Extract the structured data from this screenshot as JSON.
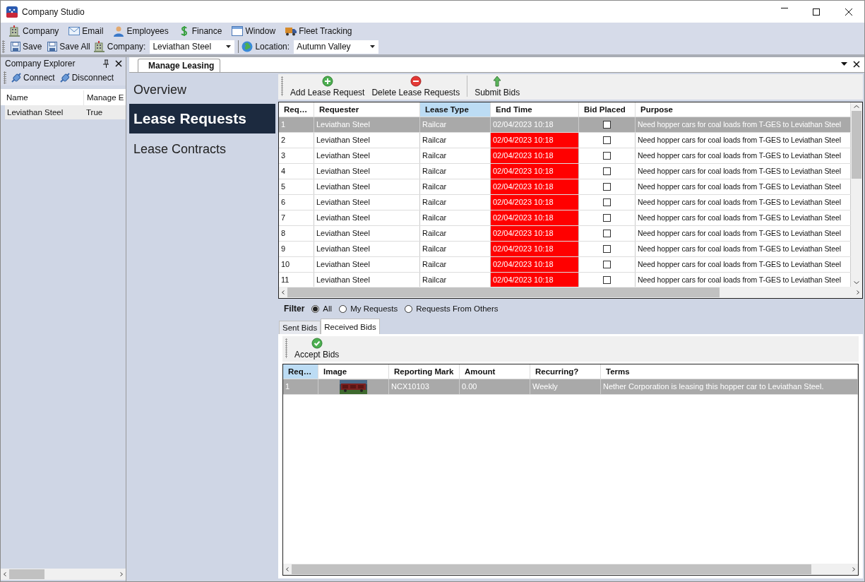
{
  "window": {
    "title": "Company Studio"
  },
  "menu": [
    {
      "label": "Company",
      "kind": "building"
    },
    {
      "label": "Email",
      "kind": "mail"
    },
    {
      "label": "Employees",
      "kind": "person"
    },
    {
      "label": "Finance",
      "kind": "dollar"
    },
    {
      "label": "Window",
      "kind": "window"
    },
    {
      "label": "Fleet Tracking",
      "kind": "truck"
    }
  ],
  "toolbar": {
    "buttons": [
      {
        "label": "Save",
        "kind": "save"
      },
      {
        "label": "Save All",
        "kind": "save"
      }
    ],
    "company": {
      "label": "Company:",
      "value": "Leviathan Steel"
    },
    "location": {
      "label": "Location:",
      "value": "Autumn Valley"
    }
  },
  "explorer": {
    "title": "Company Explorer",
    "buttons": [
      {
        "label": "Connect"
      },
      {
        "label": "Disconnect"
      }
    ],
    "columns": [
      "Name",
      "Manage E"
    ],
    "rows": [
      {
        "cells": [
          "Leviathan Steel",
          "True"
        ],
        "selected": true
      }
    ]
  },
  "document_tabs": [
    {
      "label": "Manage Leasing",
      "selected": true
    }
  ],
  "nav": [
    {
      "label": "Overview",
      "selected": false
    },
    {
      "label": "Lease Requests",
      "selected": true
    },
    {
      "label": "Lease Contracts",
      "selected": false
    }
  ],
  "requests_toolbar": [
    {
      "label": "Add Lease Request",
      "kind": "add"
    },
    {
      "label": "Delete Lease Requests",
      "kind": "delete"
    },
    {
      "label": "Submit Bids",
      "kind": "submit"
    }
  ],
  "requests_table": {
    "columns": [
      {
        "label": "Req…",
        "highlighted": false
      },
      {
        "label": "Requester",
        "highlighted": false
      },
      {
        "label": "Lease Type",
        "highlighted": true
      },
      {
        "label": "End Time",
        "highlighted": false
      },
      {
        "label": "Bid Placed",
        "highlighted": false
      },
      {
        "label": "Purpose",
        "highlighted": false
      }
    ],
    "rows": [
      {
        "req": "1",
        "requester": "Leviathan Steel",
        "lease_type": "Railcar",
        "end_time": "02/04/2023 10:18",
        "overdue": false,
        "bid_placed": false,
        "purpose": "Need hopper cars for coal loads from T-GES to Leviathan Steel",
        "selected": true
      },
      {
        "req": "2",
        "requester": "Leviathan Steel",
        "lease_type": "Railcar",
        "end_time": "02/04/2023 10:18",
        "overdue": true,
        "bid_placed": false,
        "purpose": "Need hopper cars for coal loads from T-GES to Leviathan Steel",
        "selected": false
      },
      {
        "req": "3",
        "requester": "Leviathan Steel",
        "lease_type": "Railcar",
        "end_time": "02/04/2023 10:18",
        "overdue": true,
        "bid_placed": false,
        "purpose": "Need hopper cars for coal loads from T-GES to Leviathan Steel",
        "selected": false
      },
      {
        "req": "4",
        "requester": "Leviathan Steel",
        "lease_type": "Railcar",
        "end_time": "02/04/2023 10:18",
        "overdue": true,
        "bid_placed": false,
        "purpose": "Need hopper cars for coal loads from T-GES to Leviathan Steel",
        "selected": false
      },
      {
        "req": "5",
        "requester": "Leviathan Steel",
        "lease_type": "Railcar",
        "end_time": "02/04/2023 10:18",
        "overdue": true,
        "bid_placed": false,
        "purpose": "Need hopper cars for coal loads from T-GES to Leviathan Steel",
        "selected": false
      },
      {
        "req": "6",
        "requester": "Leviathan Steel",
        "lease_type": "Railcar",
        "end_time": "02/04/2023 10:18",
        "overdue": true,
        "bid_placed": false,
        "purpose": "Need hopper cars for coal loads from T-GES to Leviathan Steel",
        "selected": false
      },
      {
        "req": "7",
        "requester": "Leviathan Steel",
        "lease_type": "Railcar",
        "end_time": "02/04/2023 10:18",
        "overdue": true,
        "bid_placed": false,
        "purpose": "Need hopper cars for coal loads from T-GES to Leviathan Steel",
        "selected": false
      },
      {
        "req": "8",
        "requester": "Leviathan Steel",
        "lease_type": "Railcar",
        "end_time": "02/04/2023 10:18",
        "overdue": true,
        "bid_placed": false,
        "purpose": "Need hopper cars for coal loads from T-GES to Leviathan Steel",
        "selected": false
      },
      {
        "req": "9",
        "requester": "Leviathan Steel",
        "lease_type": "Railcar",
        "end_time": "02/04/2023 10:18",
        "overdue": true,
        "bid_placed": false,
        "purpose": "Need hopper cars for coal loads from T-GES to Leviathan Steel",
        "selected": false
      },
      {
        "req": "10",
        "requester": "Leviathan Steel",
        "lease_type": "Railcar",
        "end_time": "02/04/2023 10:18",
        "overdue": true,
        "bid_placed": false,
        "purpose": "Need hopper cars for coal loads from T-GES to Leviathan Steel",
        "selected": false
      },
      {
        "req": "11",
        "requester": "Leviathan Steel",
        "lease_type": "Railcar",
        "end_time": "02/04/2023 10:18",
        "overdue": true,
        "bid_placed": false,
        "purpose": "Need hopper cars for coal loads from T-GES to Leviathan Steel",
        "selected": false
      }
    ]
  },
  "filter": {
    "label": "Filter",
    "options": [
      {
        "label": "All",
        "selected": true
      },
      {
        "label": "My Requests",
        "selected": false
      },
      {
        "label": "Requests From Others",
        "selected": false
      }
    ]
  },
  "bid_tabs": [
    {
      "label": "Sent Bids",
      "selected": false
    },
    {
      "label": "Received Bids",
      "selected": true
    }
  ],
  "bids_toolbar": [
    {
      "label": "Accept Bids",
      "kind": "accept"
    }
  ],
  "bids_table": {
    "columns": [
      {
        "label": "Req…",
        "highlighted": true
      },
      {
        "label": "Image",
        "highlighted": false
      },
      {
        "label": "Reporting Mark",
        "highlighted": false
      },
      {
        "label": "Amount",
        "highlighted": false
      },
      {
        "label": "Recurring?",
        "highlighted": false
      },
      {
        "label": "Terms",
        "highlighted": false
      }
    ],
    "rows": [
      {
        "req": "1",
        "reporting_mark": "NCX10103",
        "amount": "0.00",
        "recurring": "Weekly",
        "terms": "Nether Corporation is leasing this hopper car to Leviathan Steel.",
        "selected": true
      }
    ]
  }
}
